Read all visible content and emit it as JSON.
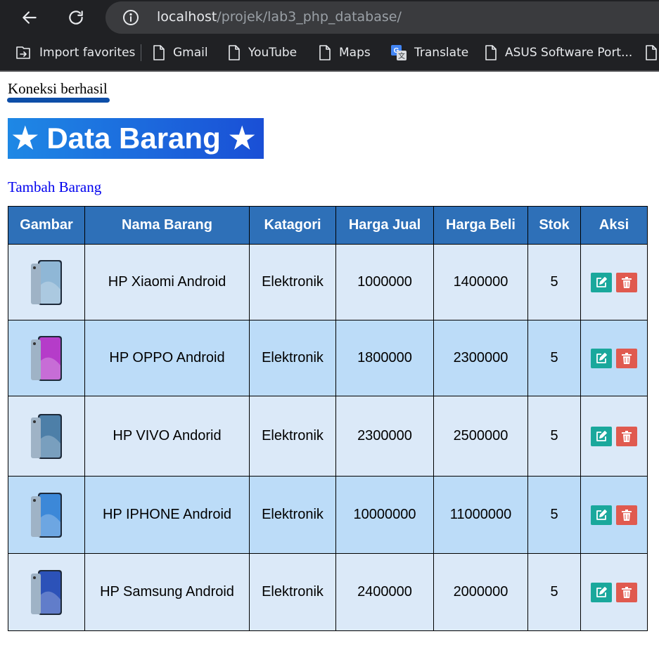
{
  "browser": {
    "url_host": "localhost",
    "url_path": "/projek/lab3_php_database/",
    "bookmarks": [
      {
        "label": "Import favorites",
        "icon": "import-favorites-icon"
      },
      {
        "label": "Gmail",
        "icon": "page-icon"
      },
      {
        "label": "YouTube",
        "icon": "page-icon"
      },
      {
        "label": "Maps",
        "icon": "page-icon"
      },
      {
        "label": "Translate",
        "icon": "translate-icon"
      },
      {
        "label": "ASUS Software Port...",
        "icon": "page-icon"
      }
    ]
  },
  "page": {
    "status": "Koneksi berhasil",
    "title": "★ Data Barang ★",
    "add_link": "Tambah Barang"
  },
  "table": {
    "headers": [
      "Gambar",
      "Nama Barang",
      "Katagori",
      "Harga Jual",
      "Harga Beli",
      "Stok",
      "Aksi"
    ],
    "rows": [
      {
        "nama": "HP Xiaomi Android",
        "kategori": "Elektronik",
        "jual": "1000000",
        "beli": "1400000",
        "stok": "5",
        "phone_color": "#8fb7d6"
      },
      {
        "nama": "HP OPPO Android",
        "kategori": "Elektronik",
        "jual": "1800000",
        "beli": "2300000",
        "stok": "5",
        "phone_color": "#b53cc9"
      },
      {
        "nama": "HP VIVO Andorid",
        "kategori": "Elektronik",
        "jual": "2300000",
        "beli": "2500000",
        "stok": "5",
        "phone_color": "#4d7fa8"
      },
      {
        "nama": "HP IPHONE Android",
        "kategori": "Elektronik",
        "jual": "10000000",
        "beli": "11000000",
        "stok": "5",
        "phone_color": "#3c88d8"
      },
      {
        "nama": "HP Samsung Android",
        "kategori": "Elektronik",
        "jual": "2400000",
        "beli": "2000000",
        "stok": "5",
        "phone_color": "#2c52b8"
      }
    ]
  },
  "colors": {
    "header_bg": "#2e70b8",
    "row_light": "#dbe9f8",
    "row_blue": "#bcdcf8",
    "edit_button": "#1aa89c",
    "delete_button": "#e05a4f"
  }
}
